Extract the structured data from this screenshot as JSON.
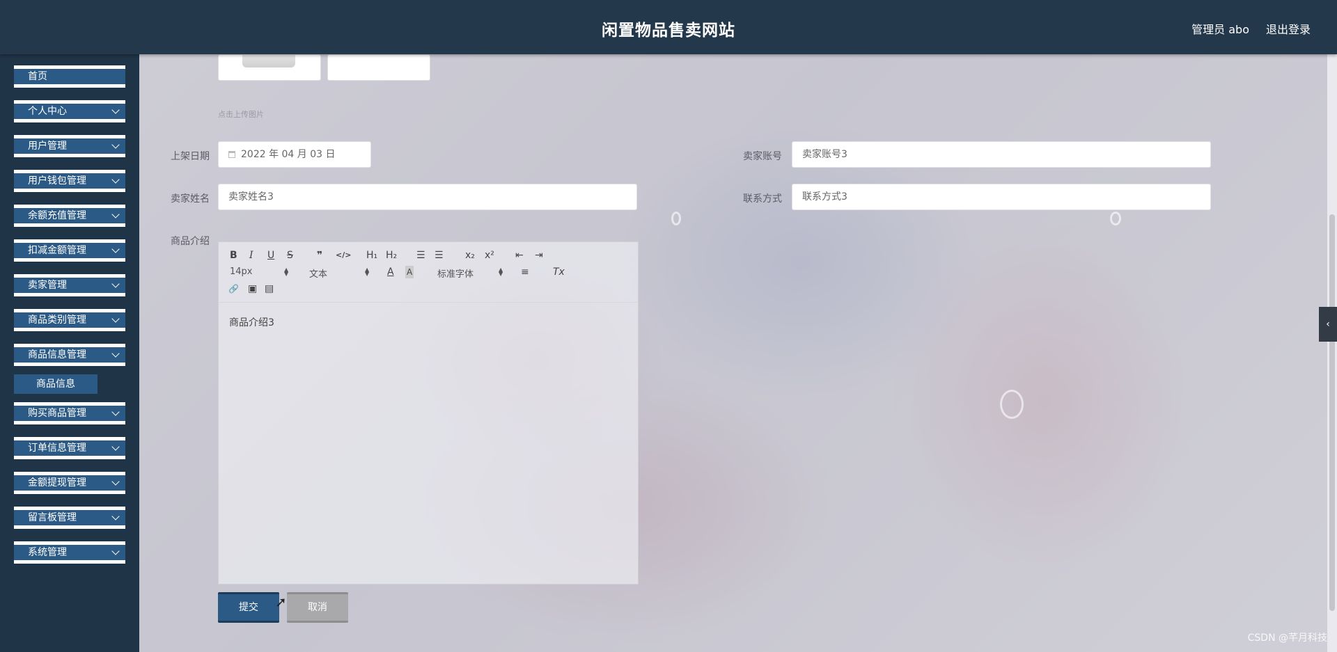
{
  "header": {
    "title": "闲置物品售卖网站",
    "user_label": "管理员 abo",
    "logout_label": "退出登录"
  },
  "sidebar": {
    "items": [
      {
        "label": "首页",
        "has_arrow": false
      },
      {
        "label": "个人中心",
        "has_arrow": true
      },
      {
        "label": "用户管理",
        "has_arrow": true
      },
      {
        "label": "用户钱包管理",
        "has_arrow": true
      },
      {
        "label": "余额充值管理",
        "has_arrow": true
      },
      {
        "label": "扣减金额管理",
        "has_arrow": true
      },
      {
        "label": "卖家管理",
        "has_arrow": true
      },
      {
        "label": "商品类别管理",
        "has_arrow": true
      },
      {
        "label": "商品信息管理",
        "has_arrow": true
      },
      {
        "label": "购买商品管理",
        "has_arrow": true
      },
      {
        "label": "订单信息管理",
        "has_arrow": true
      },
      {
        "label": "金额提现管理",
        "has_arrow": true
      },
      {
        "label": "留言板管理",
        "has_arrow": true
      },
      {
        "label": "系统管理",
        "has_arrow": true
      }
    ],
    "subitem_label": "商品信息"
  },
  "form": {
    "upload_hint": "点击上传图片",
    "listing_date_label": "上架日期",
    "listing_date_value": "2022 年 04 月 03 日",
    "seller_account_label": "卖家账号",
    "seller_account_value": "卖家账号3",
    "seller_name_label": "卖家姓名",
    "seller_name_value": "卖家姓名3",
    "contact_label": "联系方式",
    "contact_value": "联系方式3",
    "intro_label": "商品介绍",
    "editor": {
      "font_size": "14px",
      "block_type": "文本",
      "font_family": "标准字体",
      "content": "商品介绍3",
      "buttons": {
        "bold": "B",
        "italic": "I",
        "underline": "U",
        "strike": "S",
        "quote": "❞",
        "code": "</>",
        "h1": "H₁",
        "h2": "H₂",
        "ordered": "☰",
        "bullet": "☰",
        "sub": "x₂",
        "sup": "x²",
        "outdent": "⇤",
        "indent": "⇥",
        "color": "A",
        "bg": "A",
        "align": "≡",
        "clean": "Tx",
        "link": "🔗",
        "image": "▣",
        "video": "▤"
      }
    },
    "submit_label": "提交",
    "cancel_label": "取消"
  },
  "watermark": "CSDN @芊月科技",
  "colors": {
    "header_bg": "#24384c",
    "menu_bg": "#2c5a86",
    "sidebar_bg": "#203447"
  }
}
